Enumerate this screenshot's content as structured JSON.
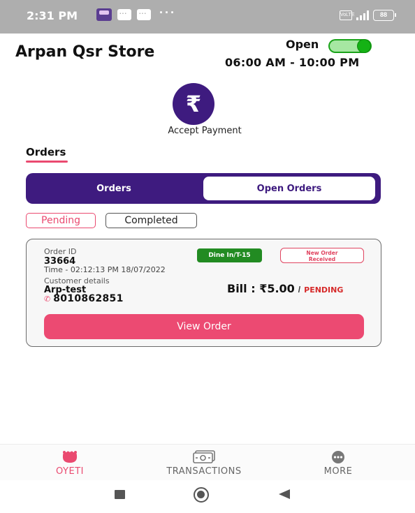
{
  "status_bar": {
    "time": "2:31 PM",
    "dots": "···",
    "vol_label": "VoLTE",
    "battery": "88"
  },
  "header": {
    "store_name": "Arpan Qsr Store",
    "open_label": "Open",
    "open_toggle_on": true,
    "hours": "06:00 AM - 10:00 PM"
  },
  "accept_payment": {
    "icon": "rupee-icon",
    "symbol": "₹",
    "label": "Accept Payment"
  },
  "orders_section": {
    "heading": "Orders"
  },
  "tabs": {
    "orders": "Orders",
    "open_orders": "Open Orders",
    "selected": "open_orders"
  },
  "filters": {
    "pending": "Pending",
    "completed": "Completed",
    "selected": "pending"
  },
  "order_card": {
    "order_id_label": "Order ID",
    "order_id": "33664",
    "time": "Time - 02:12:13 PM 18/07/2022",
    "customer_label": "Customer details",
    "customer_name": "Arp-test",
    "phone": "8010862851",
    "dine_badge": "Dine In/T-15",
    "status_badge_line1": "New Order",
    "status_badge_line2": "Received",
    "bill": "Bill : ₹5.00",
    "bill_sep": "/",
    "bill_status": "PENDING",
    "view_button": "View Order"
  },
  "bottom_nav": {
    "items": [
      {
        "label": "OYETI",
        "icon": "oyeti-icon",
        "active": true
      },
      {
        "label": "TRANSACTIONS",
        "icon": "cash-icon",
        "active": false
      },
      {
        "label": "MORE",
        "icon": "more-icon",
        "active": false
      }
    ]
  },
  "colors": {
    "brand_purple": "#3e1b7f",
    "accent_pink": "#ea4a70",
    "toggle_green": "#15b215",
    "dine_green": "#228b22"
  }
}
